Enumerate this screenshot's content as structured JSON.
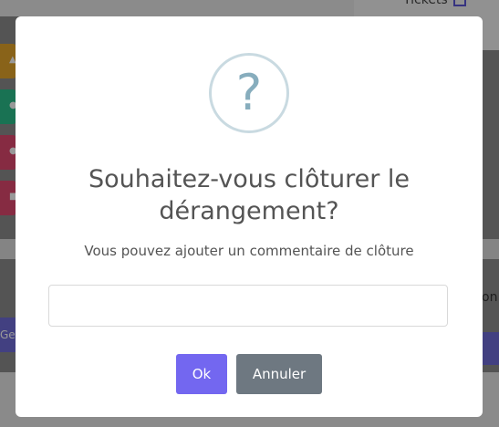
{
  "background": {
    "tickets_label": "Tickets",
    "ges_label": "Ges",
    "right_partial_label": "on"
  },
  "dialog": {
    "icon": "question-mark-icon",
    "icon_glyph": "?",
    "title": "Souhaitez-vous clôturer le dérangement?",
    "subtitle": "Vous pouvez ajouter un commentaire de clôture",
    "input_value": "",
    "ok_label": "Ok",
    "cancel_label": "Annuler"
  },
  "colors": {
    "confirm": "#7367f0",
    "cancel": "#6e7881",
    "icon": "#87adbd"
  }
}
